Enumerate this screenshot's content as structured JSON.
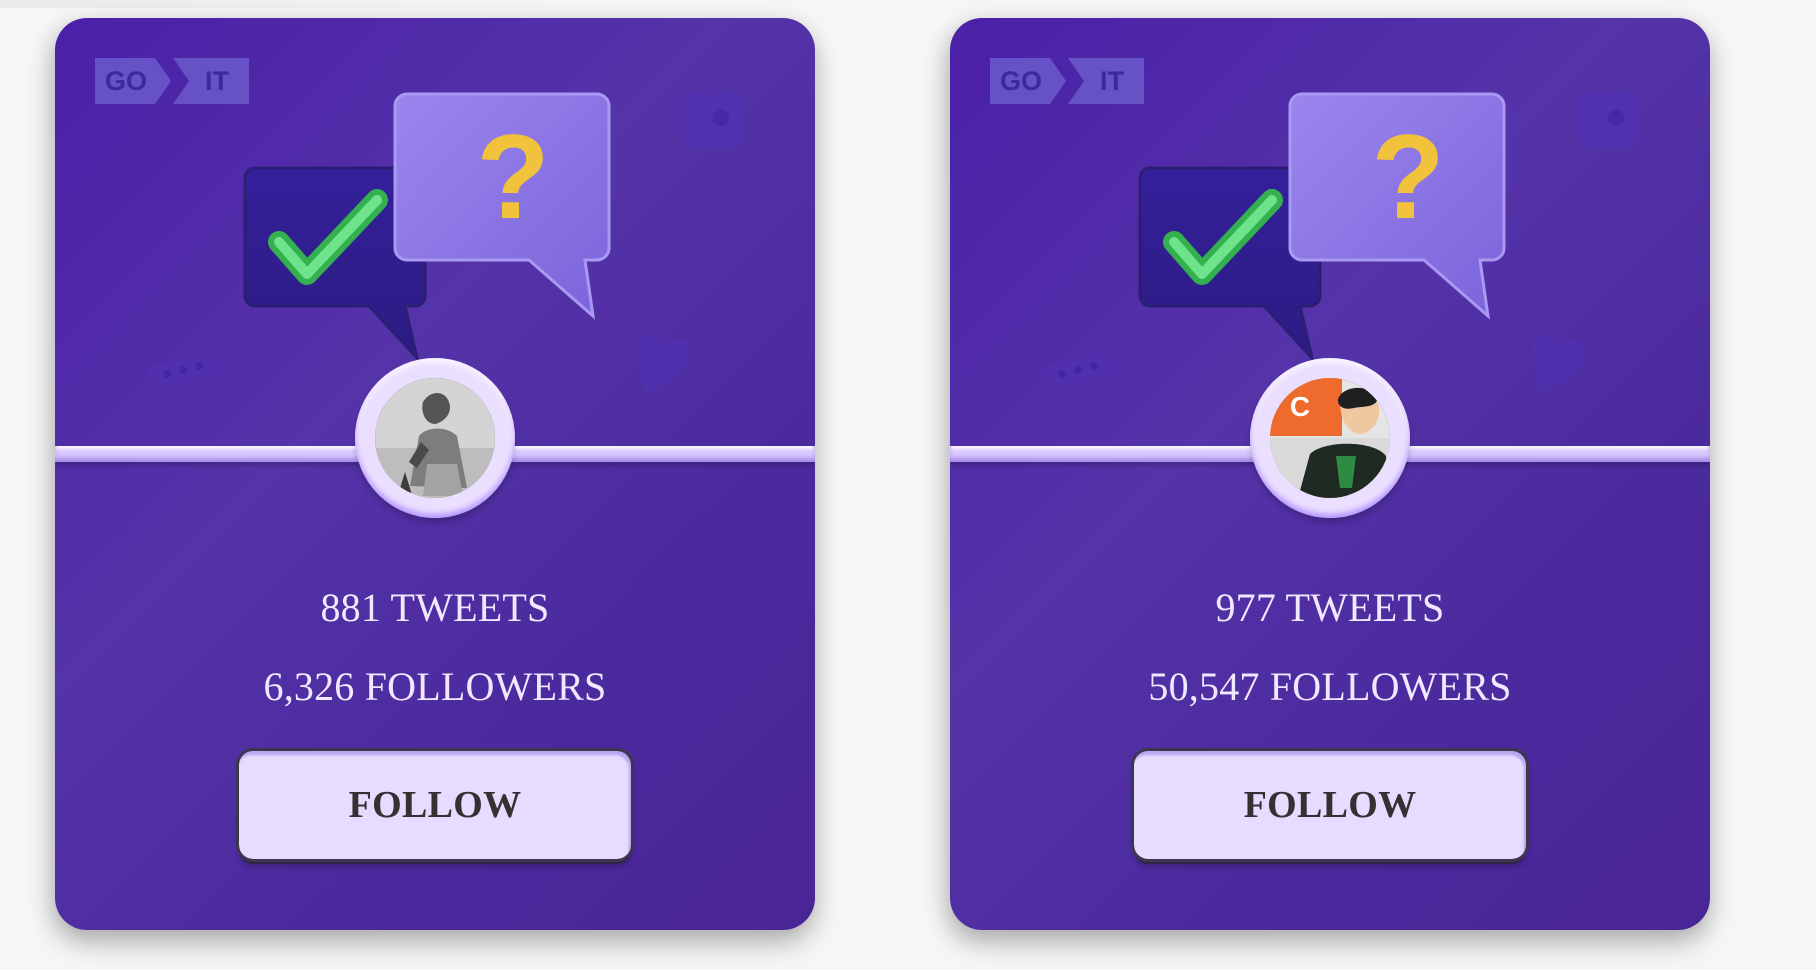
{
  "cards": [
    {
      "logo": {
        "left": "GO",
        "right": "IT"
      },
      "avatar": {
        "kind": "bw-person"
      },
      "stats": {
        "tweets": "881 TWEETS",
        "followers": "6,326 FOLLOWERS"
      },
      "button_label": "FOLLOW"
    },
    {
      "logo": {
        "left": "GO",
        "right": "IT"
      },
      "avatar": {
        "kind": "color-person",
        "sign_letter": "C"
      },
      "stats": {
        "tweets": "977 TWEETS",
        "followers": "50,547 FOLLOWERS"
      },
      "button_label": "FOLLOW"
    }
  ],
  "colors": {
    "card_bg": "#4a20a8",
    "divider": "#d8c8ff",
    "button_bg": "#e7dbff",
    "stat_text": "#f0e8ff"
  }
}
